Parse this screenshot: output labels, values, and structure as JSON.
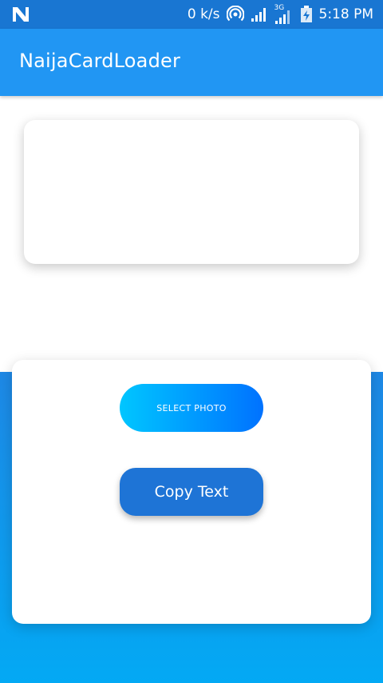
{
  "status_bar": {
    "data_rate": "0 k/s",
    "network_type": "3G",
    "time": "5:18 PM",
    "icons": [
      "app-n-icon",
      "hotspot-icon",
      "signal-icon",
      "signal-3g-icon",
      "battery-charging-icon"
    ]
  },
  "app_bar": {
    "title": "NaijaCardLoader",
    "color": "#2196F3"
  },
  "actions": {
    "select_photo_label": "SELECT PHOTO",
    "copy_text_label": "Copy Text"
  },
  "colors": {
    "status_bar": "#1976D2",
    "bottom_gradient_top": "#1E88E5",
    "bottom_gradient_bottom": "#03A9F4",
    "select_gradient_start": "#00C6FF",
    "select_gradient_end": "#0072FF",
    "copy_button": "#1E74D6"
  }
}
